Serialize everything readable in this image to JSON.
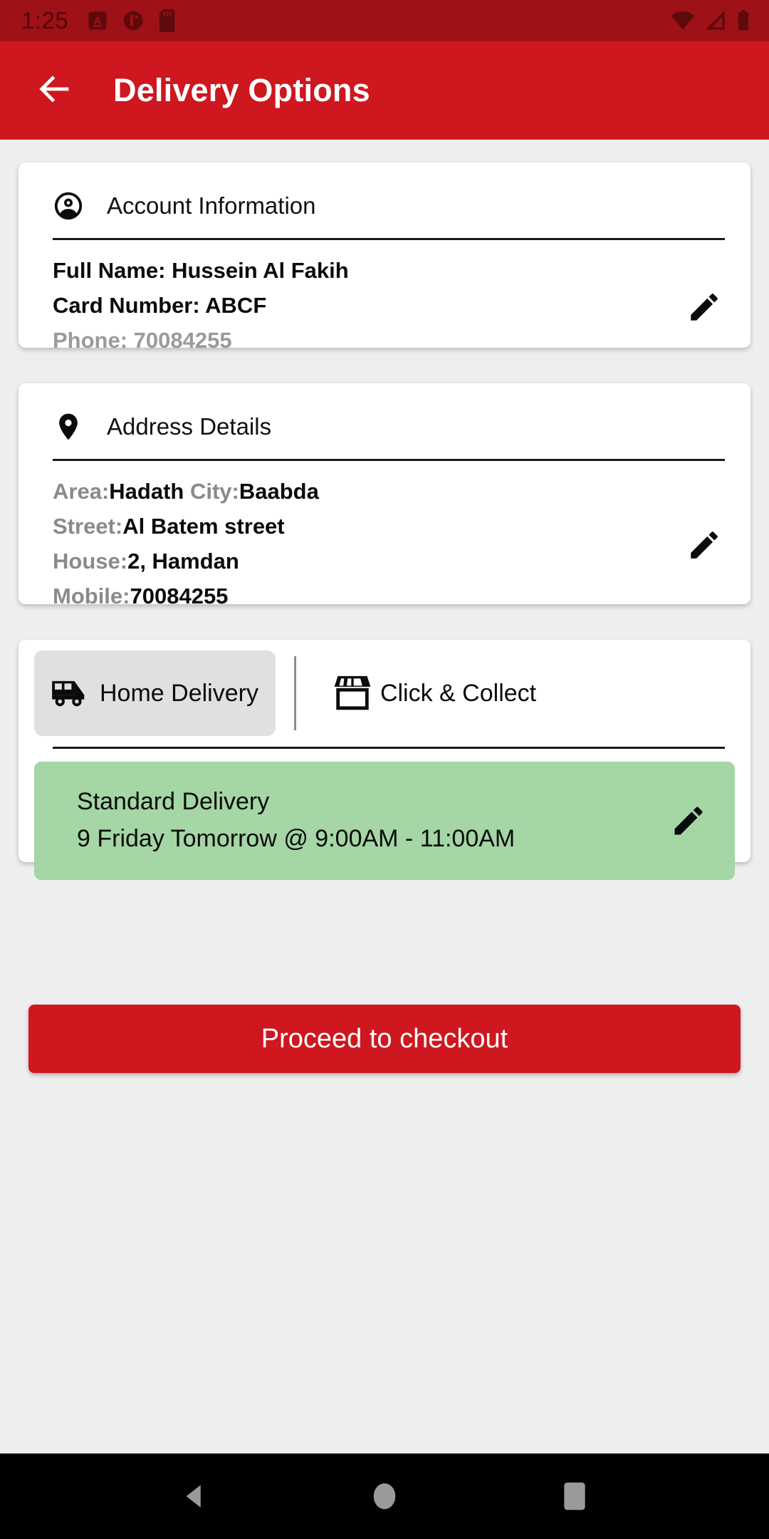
{
  "status_bar": {
    "time": "1:25",
    "left_icons": [
      "app-badge-a-icon",
      "app-badge-circle-icon",
      "sd-card-icon"
    ],
    "right_icons": [
      "wifi-icon",
      "cellular-signal-icon",
      "battery-icon"
    ],
    "background_color": "#9E1116",
    "icon_color": "#5E0A0D"
  },
  "app_bar": {
    "title": "Delivery Options",
    "back_icon": "arrow-left-icon",
    "background_color": "#CE171F",
    "text_color": "#FFFFFF"
  },
  "account_card": {
    "header_icon": "account-circle-icon",
    "header_label": "Account Information",
    "full_name_line": "Full Name: Hussein Al Fakih",
    "card_number_line": "Card Number: ABCF",
    "phone_line": "Phone: 70084255",
    "edit_icon": "pencil-edit-icon"
  },
  "address_card": {
    "header_icon": "location-pin-icon",
    "header_label": "Address Details",
    "rows": [
      {
        "label": "Area:",
        "value": "Hadath ",
        "label2": "City:",
        "value2": "Baabda"
      },
      {
        "label": "Street:",
        "value": "Al Batem street"
      },
      {
        "label": "House:",
        "value": "2, Hamdan"
      },
      {
        "label": "Mobile:",
        "value": "70084255"
      }
    ],
    "edit_icon": "pencil-edit-icon"
  },
  "delivery_card": {
    "tabs": [
      {
        "id": "home-delivery",
        "label": "Home Delivery",
        "icon": "delivery-van-icon",
        "selected": true
      },
      {
        "id": "click-collect",
        "label": "Click & Collect",
        "icon": "storefront-icon",
        "selected": false
      }
    ],
    "slot": {
      "title": "Standard Delivery",
      "subtitle": "9 Friday Tomorrow @ 9:00AM - 11:00AM",
      "background_color": "#A5D6A5",
      "edit_icon": "pencil-edit-icon"
    }
  },
  "checkout": {
    "label": "Proceed to checkout",
    "background_color": "#CE171F"
  },
  "nav_bar": {
    "back_icon": "nav-back-triangle-icon",
    "home_icon": "nav-home-circle-icon",
    "recents_icon": "nav-recents-square-icon",
    "background_color": "#000000",
    "icon_color": "#9A9A9A"
  }
}
